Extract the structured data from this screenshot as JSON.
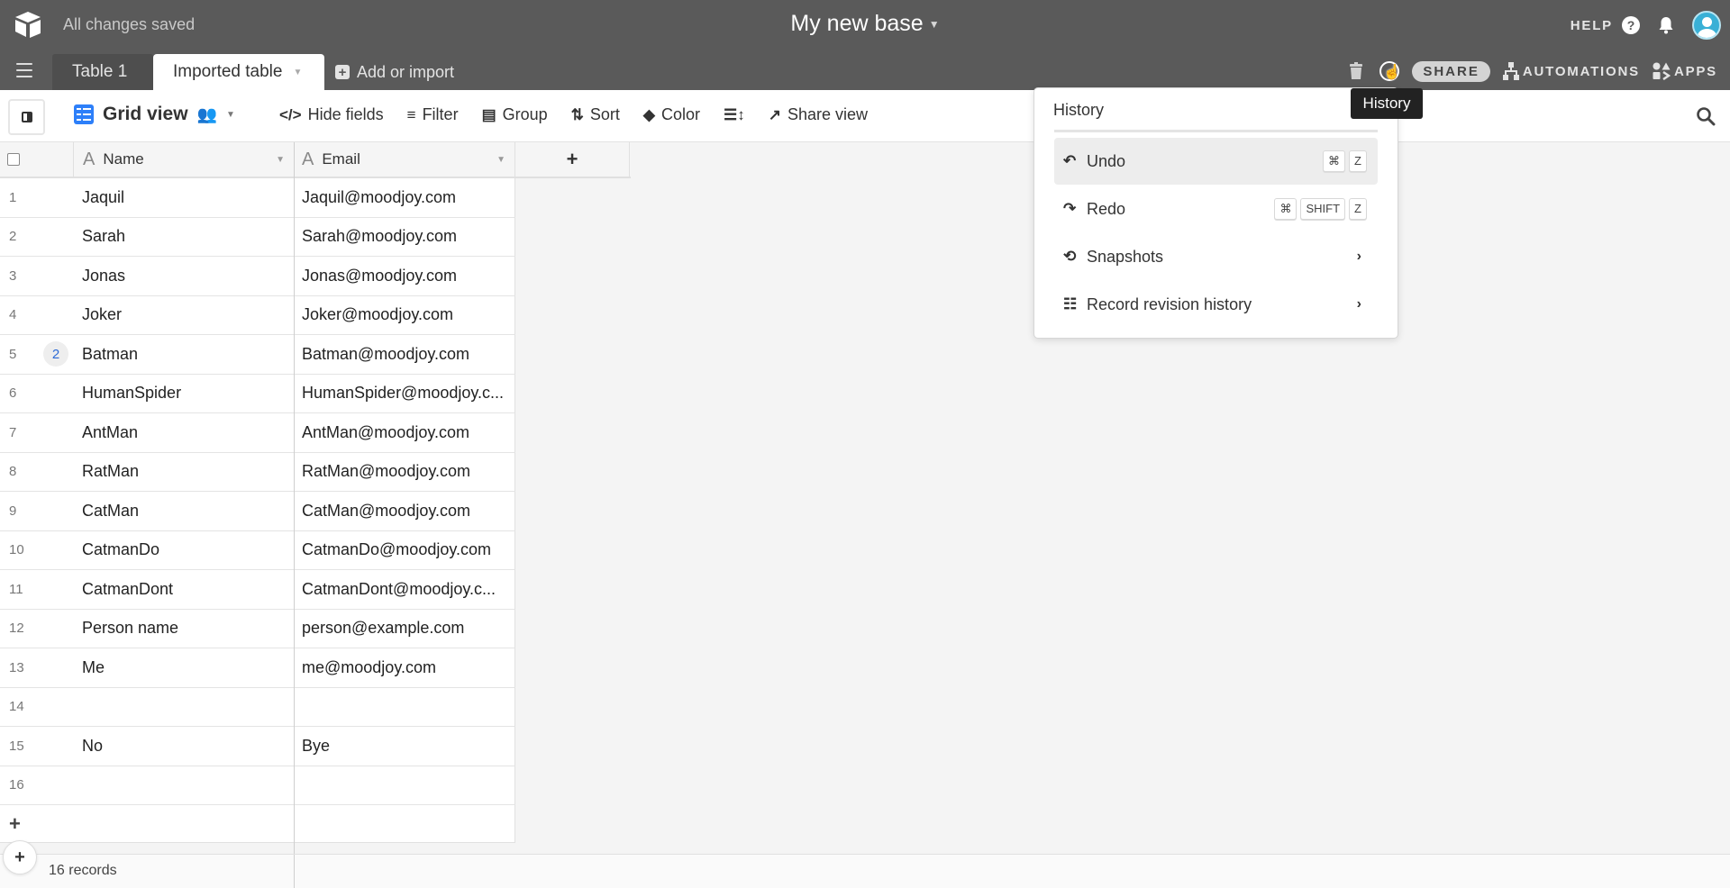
{
  "header": {
    "save_status": "All changes saved",
    "base_title": "My new base",
    "help_label": "HELP",
    "help_icon": "question-icon",
    "notifications_icon": "bell-icon",
    "avatar_icon": "user-avatar"
  },
  "tabs": {
    "items": [
      {
        "label": "Table 1",
        "active": false
      },
      {
        "label": "Imported table",
        "active": true
      }
    ],
    "add_label": "Add or import"
  },
  "tab_actions": {
    "trash_icon": "trash-icon",
    "history_icon": "history-icon",
    "share_label": "SHARE",
    "automations_label": "AUTOMATIONS",
    "apps_label": "APPS"
  },
  "viewbar": {
    "view_name": "Grid view",
    "tools": [
      {
        "label": "Hide fields",
        "icon": "hide-fields-icon"
      },
      {
        "label": "Filter",
        "icon": "filter-icon"
      },
      {
        "label": "Group",
        "icon": "group-icon"
      },
      {
        "label": "Sort",
        "icon": "sort-icon"
      },
      {
        "label": "Color",
        "icon": "color-icon"
      },
      {
        "label": "",
        "icon": "row-height-icon"
      },
      {
        "label": "Share view",
        "icon": "share-view-icon"
      }
    ]
  },
  "grid": {
    "columns": [
      {
        "name": "Name",
        "type": "text"
      },
      {
        "name": "Email",
        "type": "text"
      }
    ],
    "rows": [
      {
        "num": "1",
        "name": "Jaquil",
        "email": "Jaquil@moodjoy.com",
        "comments": ""
      },
      {
        "num": "2",
        "name": "Sarah",
        "email": "Sarah@moodjoy.com",
        "comments": ""
      },
      {
        "num": "3",
        "name": "Jonas",
        "email": "Jonas@moodjoy.com",
        "comments": ""
      },
      {
        "num": "4",
        "name": "Joker",
        "email": "Joker@moodjoy.com",
        "comments": ""
      },
      {
        "num": "5",
        "name": "Batman",
        "email": "Batman@moodjoy.com",
        "comments": "2"
      },
      {
        "num": "6",
        "name": "HumanSpider",
        "email": "HumanSpider@moodjoy.c...",
        "comments": ""
      },
      {
        "num": "7",
        "name": "AntMan",
        "email": "AntMan@moodjoy.com",
        "comments": ""
      },
      {
        "num": "8",
        "name": "RatMan",
        "email": "RatMan@moodjoy.com",
        "comments": ""
      },
      {
        "num": "9",
        "name": "CatMan",
        "email": "CatMan@moodjoy.com",
        "comments": ""
      },
      {
        "num": "10",
        "name": "CatmanDo",
        "email": "CatmanDo@moodjoy.com",
        "comments": ""
      },
      {
        "num": "11",
        "name": "CatmanDont",
        "email": "CatmanDont@moodjoy.c...",
        "comments": ""
      },
      {
        "num": "12",
        "name": "Person name",
        "email": "person@example.com",
        "comments": ""
      },
      {
        "num": "13",
        "name": "Me",
        "email": "me@moodjoy.com",
        "comments": ""
      },
      {
        "num": "14",
        "name": "",
        "email": "",
        "comments": ""
      },
      {
        "num": "15",
        "name": "No",
        "email": "Bye",
        "comments": ""
      },
      {
        "num": "16",
        "name": "",
        "email": "",
        "comments": ""
      }
    ],
    "add_row_symbol": "+",
    "add_column_symbol": "+"
  },
  "footer": {
    "record_count": "16 records"
  },
  "history_menu": {
    "title": "History",
    "items": [
      {
        "label": "Undo",
        "icon": "undo-icon",
        "keys": [
          "⌘",
          "Z"
        ],
        "highlighted": true
      },
      {
        "label": "Redo",
        "icon": "redo-icon",
        "keys": [
          "⌘",
          "SHIFT",
          "Z"
        ],
        "highlighted": false
      },
      {
        "label": "Snapshots",
        "icon": "snapshots-icon",
        "submenu": true
      },
      {
        "label": "Record revision history",
        "icon": "list-icon",
        "submenu": true
      }
    ]
  },
  "tooltip": {
    "text": "History"
  },
  "colors": {
    "topbar": "#5a5a5a",
    "accent_blue": "#2d7ff9",
    "avatar": "#39b0d6"
  }
}
